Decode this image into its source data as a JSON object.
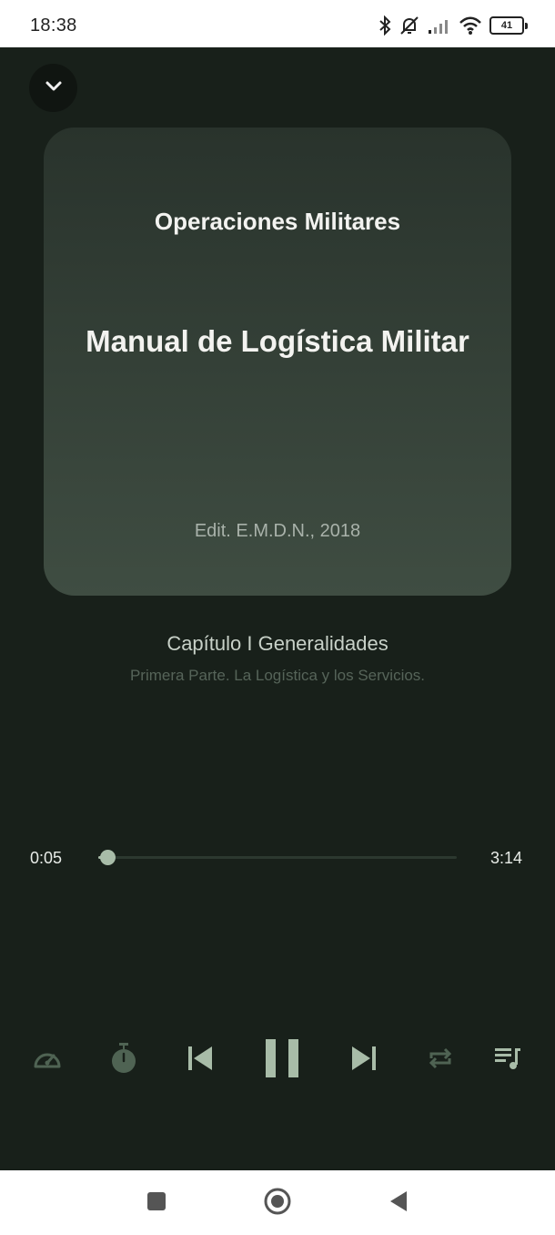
{
  "status_bar": {
    "time": "18:38",
    "battery": "41",
    "icons": [
      "bluetooth-icon",
      "muted-bell-icon",
      "signal-icon",
      "wifi-icon",
      "battery-icon"
    ]
  },
  "player": {
    "cover": {
      "series": "Operaciones Militares",
      "title": "Manual de Logística Militar",
      "edition": "Edit. E.M.D.N., 2018"
    },
    "chapter_title": "Capítulo I Generalidades",
    "part_title": "Primera Parte. La Logística y los Servicios.",
    "elapsed": "0:05",
    "duration": "3:14",
    "progress_fraction": 0.026,
    "controls": [
      "speed-icon",
      "sleep-timer-icon",
      "previous-icon",
      "pause-icon",
      "next-icon",
      "repeat-icon",
      "playlist-icon"
    ],
    "colors": {
      "background": "#18201a",
      "accent": "#a8bca8",
      "muted_icon": "#4f6353"
    }
  },
  "nav_bar": {
    "buttons": [
      "recents-icon",
      "home-icon",
      "back-icon"
    ]
  }
}
